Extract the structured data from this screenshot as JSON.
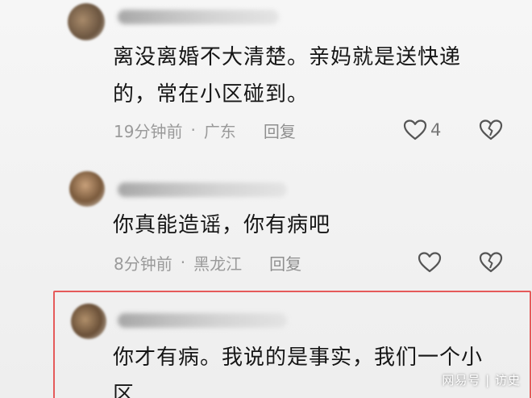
{
  "comments": [
    {
      "text_line1": "离没离婚不大清楚。亲妈就是送快递",
      "text_line2": "的，常在小区碰到。",
      "time": "19分钟前",
      "location": "广东",
      "reply_label": "回复",
      "like_count": "4"
    },
    {
      "text_line1": "你真能造谣，你有病吧",
      "time": "8分钟前",
      "location": "黑龙江",
      "reply_label": "回复"
    },
    {
      "text_line1": "你才有病。我说的是事实，我们一个小",
      "text_line2": "区"
    }
  ],
  "meta_separator": "·",
  "watermark": "网易号 | 访史",
  "colors": {
    "highlight_border": "#e55a5a",
    "meta_text": "#9a9a9a",
    "body_text": "#161616"
  }
}
